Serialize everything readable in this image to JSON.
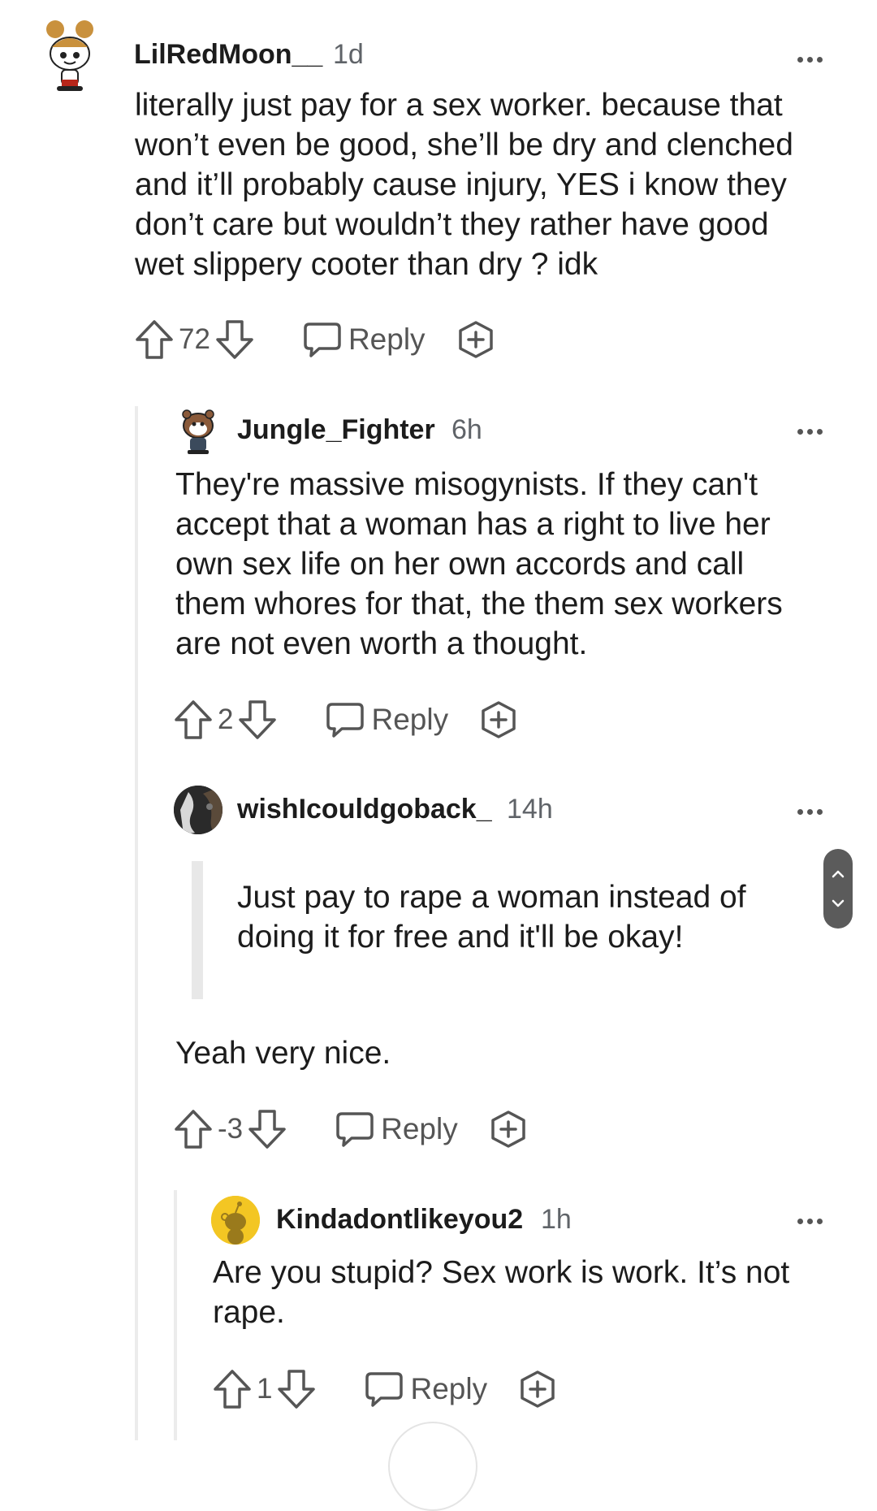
{
  "comments": [
    {
      "username": "LilRedMoon__",
      "time": "1d",
      "lines": [
        "literally just pay for a sex worker. because that",
        "won’t even be good, she’ll be dry and clenched",
        "and it’ll probably cause injury, YES i know they",
        "don’t care but wouldn’t they rather have good",
        "wet slippery cooter than dry ? idk"
      ],
      "score": "72",
      "reply_label": "Reply"
    },
    {
      "username": "Jungle_Fighter",
      "time": "6h",
      "lines": [
        "They're massive misogynists. If they can't",
        "accept that a woman has a right to live her",
        "own sex life on her own accords and call",
        "them whores for that, the them sex workers",
        "are not even worth a thought."
      ],
      "score": "2",
      "reply_label": "Reply"
    },
    {
      "username": "wishIcouldgoback_",
      "time": "14h",
      "quote_lines": [
        "Just pay to rape a woman instead of",
        "doing it for free and it'll be okay!"
      ],
      "text": "Yeah very nice.",
      "score": "-3",
      "reply_label": "Reply"
    },
    {
      "username": "Kindadontlikeyou2",
      "time": "1h",
      "lines": [
        "Are you stupid? Sex work is work. It’s not",
        "rape."
      ],
      "score": "1",
      "reply_label": "Reply"
    }
  ],
  "icons": {
    "upvote": "arrow-up-outline",
    "downvote": "arrow-down-outline",
    "reply": "speech-bubble",
    "award": "plus-badge",
    "more": "three-dots",
    "scroll": "chevron-up-down"
  },
  "colors": {
    "text": "#1c1c1c",
    "muted": "#555555",
    "thread_line": "#ececec",
    "award_yellow": "#f3c623"
  }
}
